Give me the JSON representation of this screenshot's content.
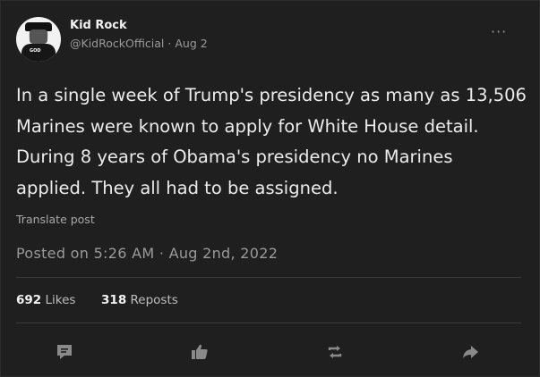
{
  "author": {
    "name": "Kid Rock",
    "handle": "@KidRockOfficial",
    "separator": "·",
    "date": "Aug 2",
    "avatar_text": "GOD"
  },
  "more_label": "···",
  "post": {
    "text": "In a single week of Trump's presidency as many as 13,506 Marines were known to apply for White House detail. During 8 years of Obama's presidency no Marines applied. They all had to be assigned."
  },
  "translate_label": "Translate post",
  "posted_line": "Posted on 5:26 AM · Aug 2nd, 2022",
  "stats": {
    "likes_count": "692",
    "likes_label": "Likes",
    "reposts_count": "318",
    "reposts_label": "Reposts"
  },
  "actions": [
    {
      "name": "comment-icon"
    },
    {
      "name": "like-icon"
    },
    {
      "name": "repost-icon"
    },
    {
      "name": "share-icon"
    }
  ],
  "colors": {
    "background": "#1f1f1f",
    "text": "#ececec",
    "muted": "#9a9a9a",
    "icon": "#8a8a8a"
  }
}
